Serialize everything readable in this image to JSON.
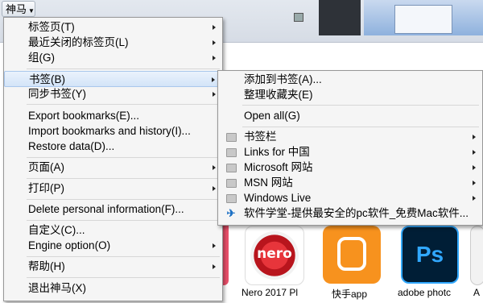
{
  "app_button": {
    "label": "神马"
  },
  "tiles": [
    {
      "label": "Nero 2017 Pl",
      "logo_text": "nero"
    },
    {
      "label": "快手app"
    },
    {
      "label": "adobe photc",
      "logo_text": "Ps"
    },
    {
      "label": "A"
    }
  ],
  "main_menu": {
    "items": [
      {
        "label": "标签页(T)",
        "submenu": true
      },
      {
        "label": "最近关闭的标签页(L)",
        "submenu": true
      },
      {
        "label": "组(G)",
        "submenu": true
      },
      {
        "label": "书签(B)",
        "submenu": true,
        "active": true
      },
      {
        "label": "同步书签(Y)",
        "submenu": true
      },
      {
        "label": "Export bookmarks(E)...",
        "submenu": false
      },
      {
        "label": "Import bookmarks and history(I)...",
        "submenu": false
      },
      {
        "label": "Restore data(D)...",
        "submenu": false
      },
      {
        "label": "页面(A)",
        "submenu": true
      },
      {
        "label": "打印(P)",
        "submenu": true
      },
      {
        "label": "Delete personal information(F)...",
        "submenu": false
      },
      {
        "label": "自定义(C)...",
        "submenu": false
      },
      {
        "label": "Engine option(O)",
        "submenu": true
      },
      {
        "label": "帮助(H)",
        "submenu": true
      },
      {
        "label": "退出神马(X)",
        "submenu": false
      }
    ]
  },
  "bookmarks_menu": {
    "items": [
      {
        "label": "添加到书签(A)...",
        "icon": ""
      },
      {
        "label": "整理收藏夹(E)",
        "icon": ""
      },
      {
        "label": "Open all(G)",
        "icon": ""
      },
      {
        "label": "书签栏",
        "icon": "folder-icon",
        "submenu": true
      },
      {
        "label": "Links for 中国",
        "icon": "folder-icon",
        "submenu": true
      },
      {
        "label": "Microsoft 网站",
        "icon": "folder-icon",
        "submenu": true
      },
      {
        "label": "MSN 网站",
        "icon": "folder-icon",
        "submenu": true
      },
      {
        "label": "Windows Live",
        "icon": "folder-icon",
        "submenu": true
      },
      {
        "label": "软件学堂-提供最安全的pc软件_免费Mac软件...",
        "icon": "site-favicon-icon",
        "submenu": false
      }
    ]
  }
}
